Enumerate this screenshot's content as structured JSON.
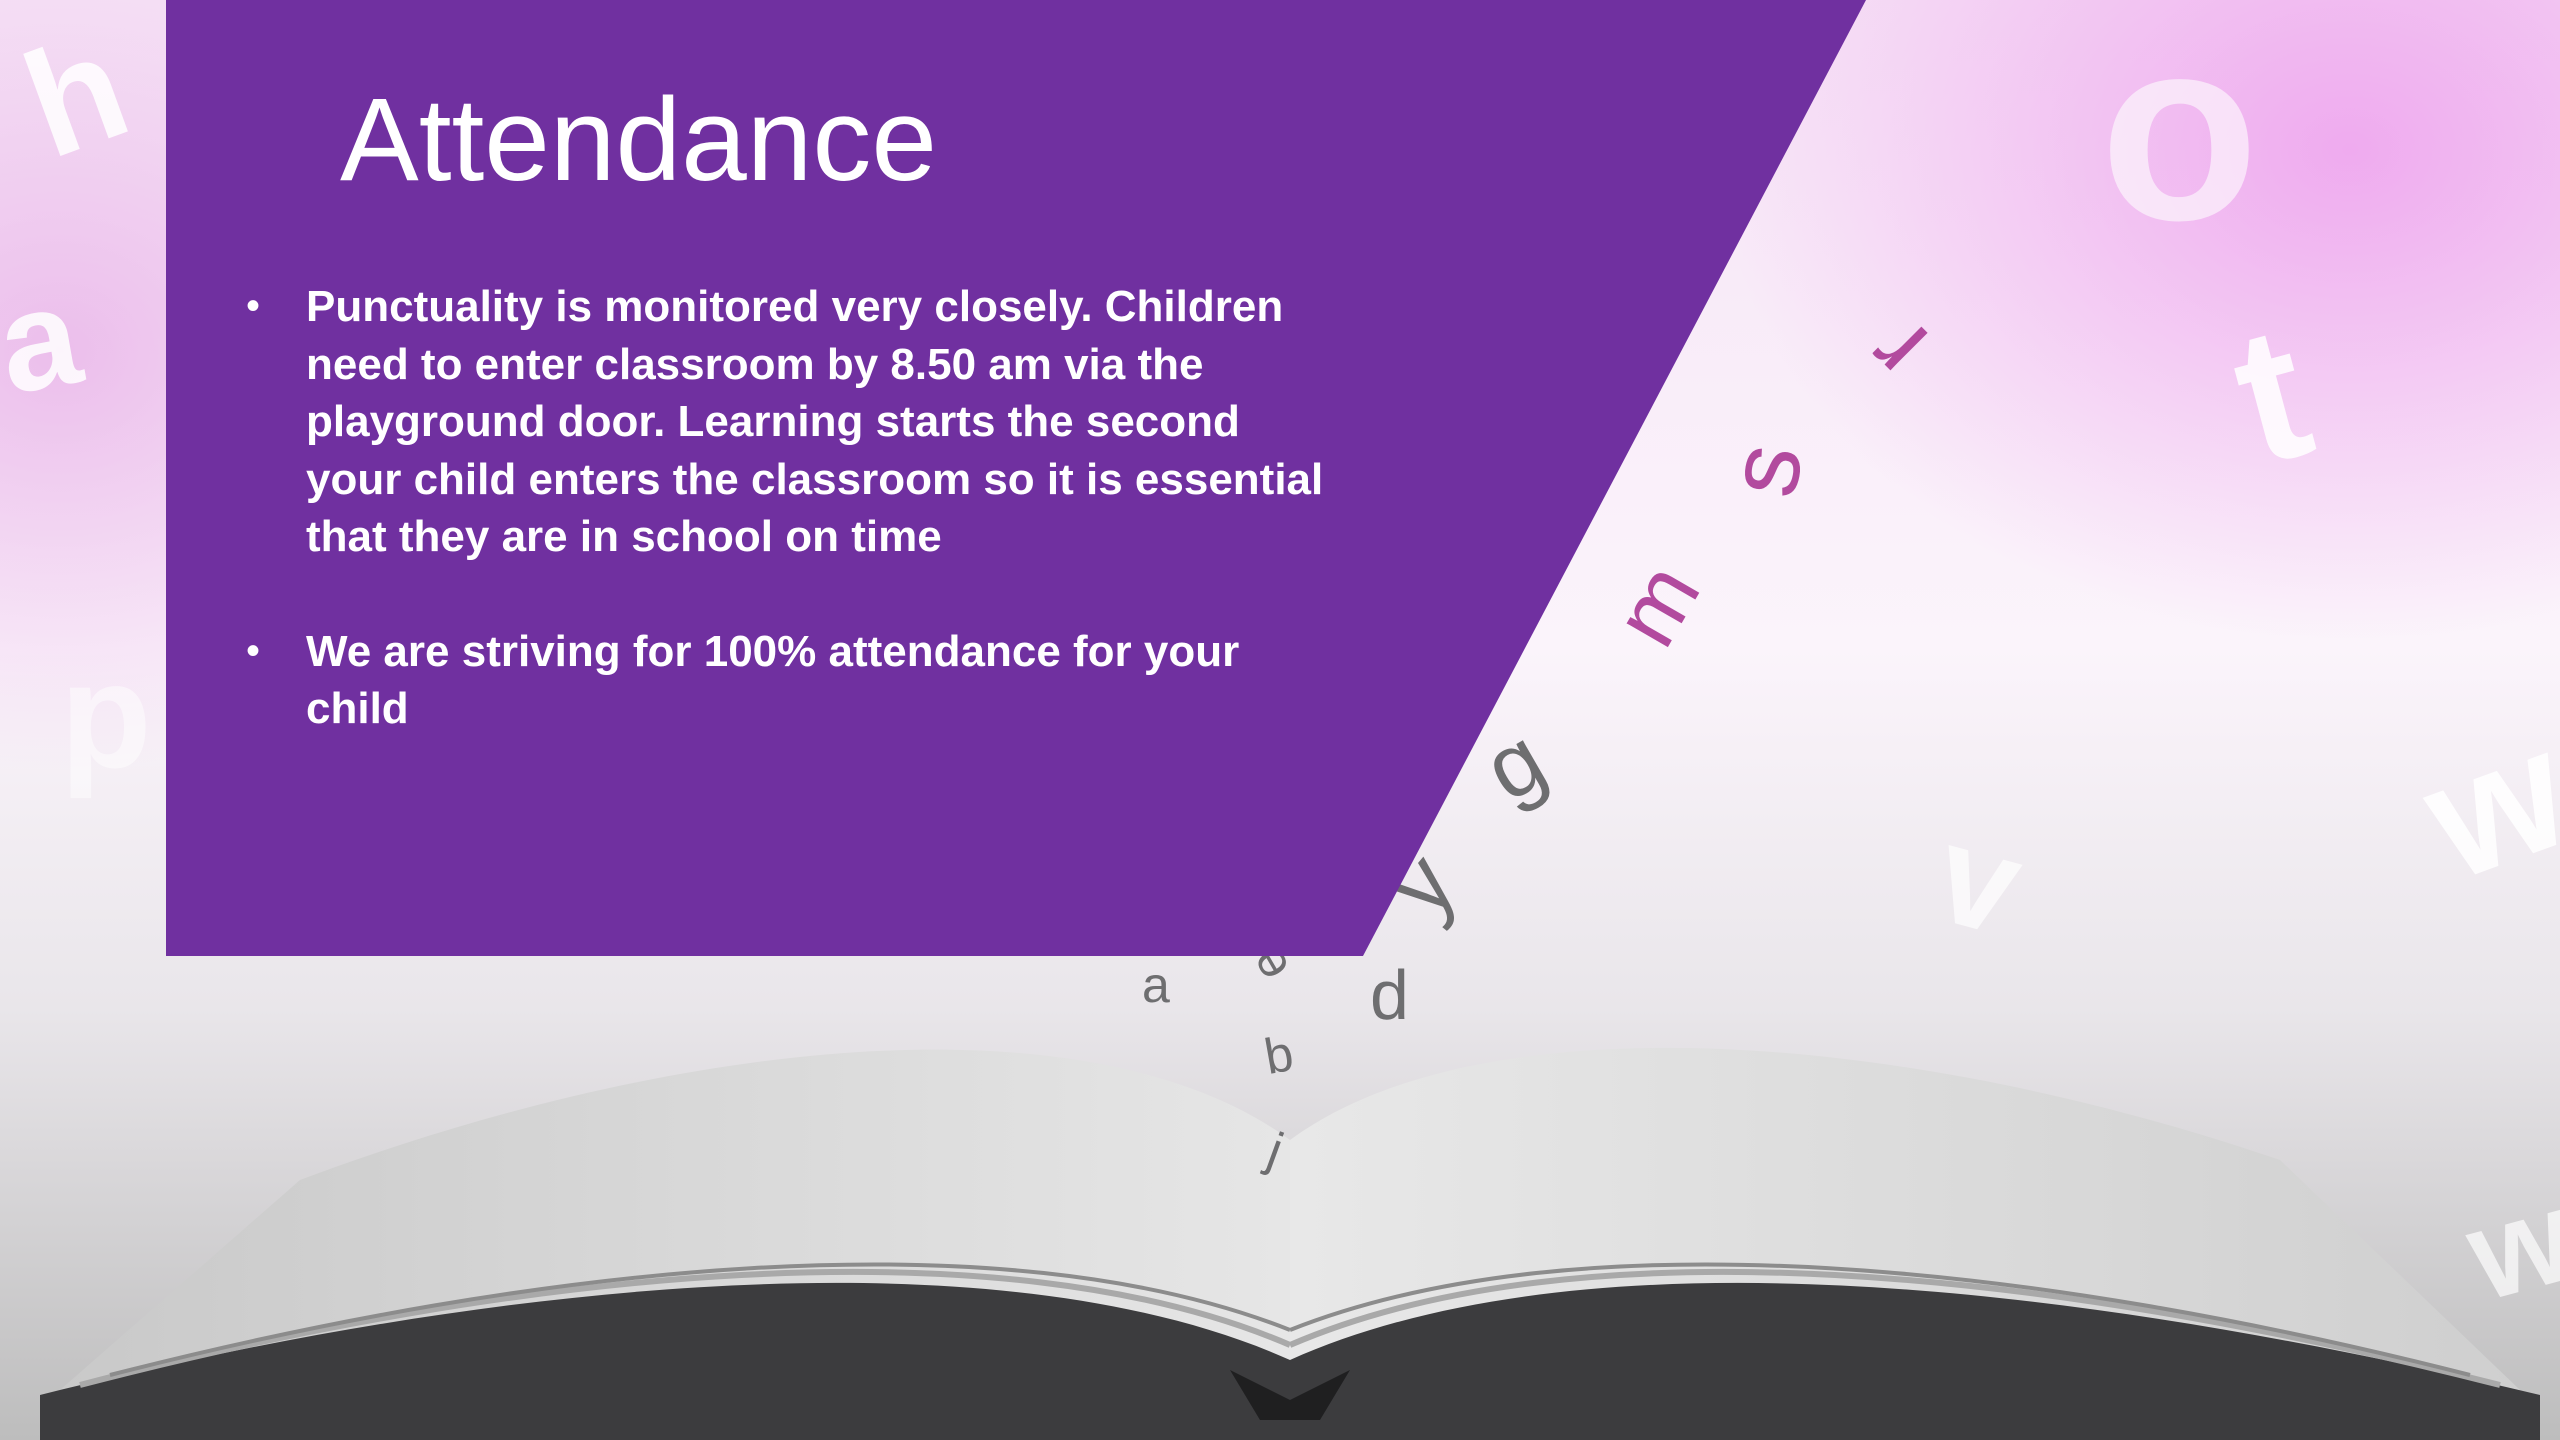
{
  "slide": {
    "title": "Attendance",
    "bullets": [
      {
        "text": "Punctuality is monitored very closely. Children need to enter classroom by 8.50 am via the playground door. Learning starts the second your child enters the classroom so it is essential that they are in school on time"
      },
      {
        "text": "We are striving for 100% attendance for your child"
      }
    ],
    "bullet_symbol": "•"
  },
  "background": {
    "floating_letters": [
      "h",
      "a",
      "p",
      "o",
      "t",
      "w",
      "r",
      "s",
      "m",
      "g",
      "y",
      "a",
      "d",
      "b",
      "j",
      "e",
      "v",
      "w"
    ]
  },
  "colors": {
    "panel": "#7030a0",
    "text": "#ffffff",
    "pink_letters": "#b24a9e",
    "grey_letters": "#6e6e70"
  }
}
